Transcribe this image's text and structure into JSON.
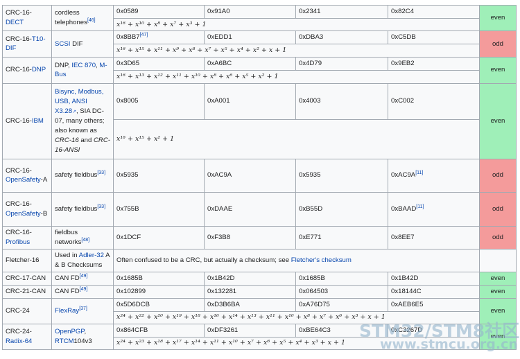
{
  "rows": [
    {
      "name_a": "CRC-16-",
      "name_link": "DECT",
      "name_b": "",
      "use": "cordless telephones",
      "use_ref": "[46]",
      "normal": "0x0589",
      "reversed": "0x91A0",
      "reciprocal": "0x2341",
      "rev_reciprocal": "0x82C4",
      "poly": "x¹⁶ + x¹⁰ + x⁸ + x⁷ + x³ + 1",
      "parity": "even"
    },
    {
      "name_a": "CRC-16-",
      "name_link": "T10-DIF",
      "name_b": "",
      "use_link": "SCSI",
      "use_tail": " DIF",
      "normal": "0x8BB7",
      "normal_ref": "[47]",
      "reversed": "0xEDD1",
      "reciprocal": "0xDBA3",
      "rev_reciprocal": "0xC5DB",
      "poly": "x¹⁶ + x¹⁵ + x¹¹ + x⁹ + x⁸ + x⁷ + x⁵ + x⁴ + x² + x + 1",
      "parity": "odd"
    },
    {
      "name_a": "CRC-16-",
      "name_link": "DNP",
      "use_pre": "DNP, ",
      "use_link": "IEC 870",
      "use_sep": ", ",
      "use_link2": "M-Bus",
      "normal": "0x3D65",
      "reversed": "0xA6BC",
      "reciprocal": "0x4D79",
      "rev_reciprocal": "0x9EB2",
      "poly": "x¹⁶ + x¹³ + x¹² + x¹¹ + x¹⁰ + x⁸ + x⁶ + x⁵ + x² + 1",
      "parity": "even"
    },
    {
      "name_a": "CRC-16-",
      "name_link": "IBM",
      "use_links": "Bisync, Modbus, USB, ANSI X3.28",
      "use_mid": ", SIA DC-07, many others; also known as ",
      "use_em1": "CRC-16",
      "use_and": " and ",
      "use_em2": "CRC-16-ANSI",
      "normal": "0x8005",
      "reversed": "0xA001",
      "reciprocal": "0x4003",
      "rev_reciprocal": "0xC002",
      "poly": "x¹⁶ + x¹⁵ + x² + 1",
      "parity": "even"
    },
    {
      "name_a": "CRC-16-",
      "name_link": "OpenSafety",
      "name_b": "-A",
      "use": "safety fieldbus",
      "use_ref": "[33]",
      "normal": "0x5935",
      "reversed": "0xAC9A",
      "reciprocal": "0x5935",
      "rev_reciprocal": "0xAC9A",
      "rr_ref": "[11]",
      "parity": "odd"
    },
    {
      "name_a": "CRC-16-",
      "name_link": "OpenSafety",
      "name_b": "-B",
      "use": "safety fieldbus",
      "use_ref": "[33]",
      "normal": "0x755B",
      "reversed": "0xDAAE",
      "reciprocal": "0xB55D",
      "rev_reciprocal": "0xBAAD",
      "rr_ref": "[11]",
      "parity": "odd"
    },
    {
      "name_a": "CRC-16-",
      "name_link": "Profibus",
      "use": "fieldbus networks",
      "use_ref": "[48]",
      "normal": "0x1DCF",
      "reversed": "0xF3B8",
      "reciprocal": "0xE771",
      "rev_reciprocal": "0x8EE7",
      "parity": "odd"
    },
    {
      "name_a": "Fletcher-16",
      "use_pre": "Used in ",
      "use_link": "Adler-32",
      "use_tail": " A & B Checksums",
      "note": "Often confused to be a CRC, but actually a checksum; see ",
      "note_link": "Fletcher's checksum"
    },
    {
      "name_a": "CRC-17-CAN",
      "use": "CAN FD",
      "use_ref": "[49]",
      "normal": "0x1685B",
      "reversed": "0x1B42D",
      "reciprocal": "0x1685B",
      "rev_reciprocal": "0x1B42D",
      "parity": "even"
    },
    {
      "name_a": "CRC-21-CAN",
      "use": "CAN FD",
      "use_ref": "[49]",
      "normal": "0x102899",
      "reversed": "0x132281",
      "reciprocal": "0x064503",
      "rev_reciprocal": "0x18144C",
      "parity": "even"
    },
    {
      "name_a": "CRC-24",
      "use_link": "FlexRay",
      "use_ref": "[37]",
      "normal": "0x5D6DCB",
      "reversed": "0xD3B6BA",
      "reciprocal": "0xA76D75",
      "rev_reciprocal": "0xAEB6E5",
      "poly": "x²⁴ + x²² + x²⁰ + x¹⁹ + x¹⁸ + x¹⁶ + x¹⁴ + x¹³ + x¹¹ + x¹⁰ + x⁸ + x⁷ + x⁶ + x³ + x + 1",
      "parity": "even"
    },
    {
      "name_a": "CRC-24-",
      "name_link": "Radix-64",
      "use_link": "OpenPGP",
      "use_sep": ", ",
      "use_link2": "RTCM",
      "use_tail": "104v3",
      "normal": "0x864CFB",
      "reversed": "0xDF3261",
      "reciprocal": "0xBE64C3",
      "rev_reciprocal": "0xC3267D",
      "poly": "x²⁴ + x²³ + x¹⁸ + x¹⁷ + x¹⁴ + x¹¹ + x¹⁰ + x⁷ + x⁶ + x⁵ + x⁴ + x³ + x + 1",
      "parity": "even"
    }
  ],
  "watermark": {
    "line1": "STM32/STM8社区",
    "line2": "www.stmcu.org.cn"
  },
  "colors": {
    "even": "#9fefb8",
    "odd": "#f49b9b",
    "link": "#0645ad",
    "border": "#a2a9b1"
  }
}
